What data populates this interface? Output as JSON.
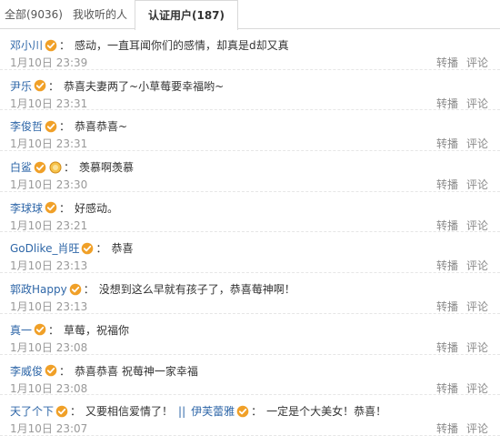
{
  "tabs": [
    {
      "label": "全部(9036)"
    },
    {
      "label": "我收听的人"
    },
    {
      "label": "认证用户(187)"
    }
  ],
  "colors": {
    "name": "#2f67a8",
    "badge": "#f0a028",
    "time": "#999999",
    "action": "#8a8a8a"
  },
  "actions": {
    "repost": "转播",
    "comment": "评论"
  },
  "comments": [
    {
      "name": "邓小川",
      "colon": "：",
      "text": "感动，一直耳闻你们的感情，却真是d却又真",
      "time": "1月10日 23:39"
    },
    {
      "name": "尹乐",
      "colon": "：",
      "text": "恭喜夫妻两了~小草莓要幸福哟~",
      "time": "1月10日 23:31"
    },
    {
      "name": "李俊哲",
      "colon": "：",
      "text": "恭喜恭喜~",
      "time": "1月10日 23:31"
    },
    {
      "name": "白鲨",
      "colon": "：",
      "text": "羡慕啊羡慕",
      "time": "1月10日 23:30",
      "extra_icon": "medal-icon"
    },
    {
      "name": "李球球",
      "colon": "：",
      "text": "好感动。",
      "time": "1月10日 23:21"
    },
    {
      "name": "GoDlike_肖旺",
      "colon": "：",
      "text": "恭喜",
      "time": "1月10日 23:13"
    },
    {
      "name": "郭政Happy",
      "colon": "：",
      "text": "没想到这么早就有孩子了，恭喜莓神啊！",
      "time": "1月10日 23:13"
    },
    {
      "name": "真一",
      "colon": "：",
      "text": "草莓，祝福你",
      "time": "1月10日 23:08"
    },
    {
      "name": "李威俊",
      "colon": "：",
      "text": "恭喜恭喜 祝莓神一家幸福",
      "time": "1月10日 23:08"
    },
    {
      "name": "天了个下",
      "colon": "：",
      "text": "又要相信爱情了！",
      "sep": "||",
      "name2": "伊芙蕾雅",
      "colon2": "：",
      "text2": "一定是个大美女！恭喜！",
      "time": "1月10日 23:07"
    }
  ]
}
